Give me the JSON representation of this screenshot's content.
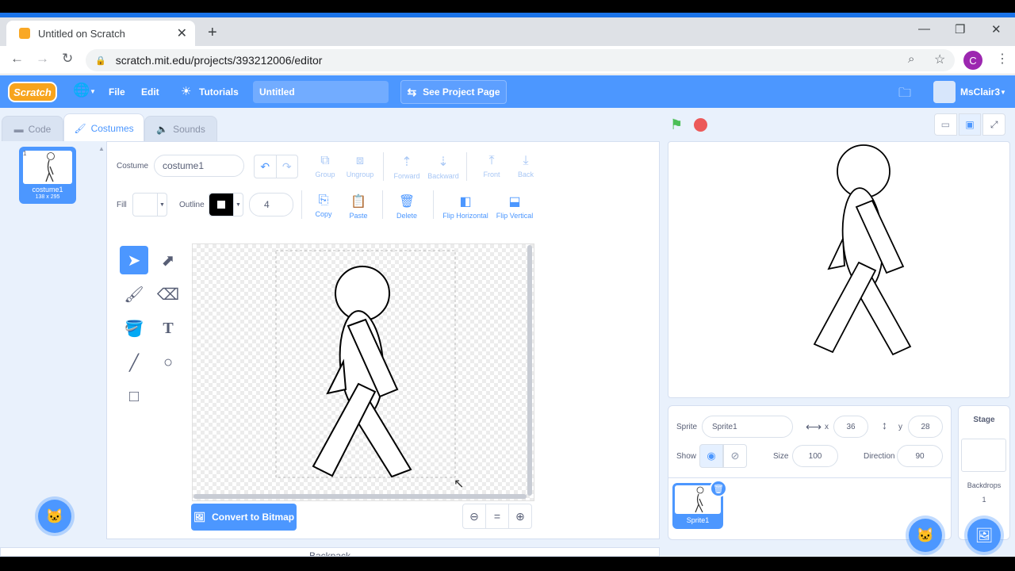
{
  "browser": {
    "tab_title": "Untitled on Scratch",
    "tab_close": "✕",
    "new_tab": "+",
    "url": "scratch.mit.edu/projects/393212006/editor",
    "profile_initial": "C",
    "window_controls": [
      "—",
      "❐",
      "✕"
    ]
  },
  "menubar": {
    "logo": "Scratch",
    "file": "File",
    "edit": "Edit",
    "tutorials": "Tutorials",
    "project_title": "Untitled",
    "see_project_page": "See Project Page",
    "username": "MsClair3"
  },
  "tabs": {
    "code": "Code",
    "costumes": "Costumes",
    "sounds": "Sounds"
  },
  "costume_list": [
    {
      "number": "1",
      "name": "costume1",
      "size": "138 x 295"
    }
  ],
  "paint": {
    "costume_label": "Costume",
    "costume_name": "costume1",
    "group": "Group",
    "ungroup": "Ungroup",
    "forward": "Forward",
    "backward": "Backward",
    "front": "Front",
    "back": "Back",
    "fill_label": "Fill",
    "outline_label": "Outline",
    "outline_width": "4",
    "copy": "Copy",
    "paste": "Paste",
    "delete": "Delete",
    "flip_horizontal": "Flip Horizontal",
    "flip_vertical": "Flip Vertical",
    "convert_bitmap": "Convert to Bitmap",
    "zoom_reset": "="
  },
  "backpack": "Backpack",
  "sprite": {
    "sprite_label": "Sprite",
    "sprite_name": "Sprite1",
    "x_label": "x",
    "x": "36",
    "y_label": "y",
    "y": "28",
    "show_label": "Show",
    "size_label": "Size",
    "size": "100",
    "direction_label": "Direction",
    "direction": "90",
    "thumb_name": "Sprite1"
  },
  "stage_panel": {
    "title": "Stage",
    "backdrops_label": "Backdrops",
    "backdrops_count": "1"
  },
  "colors": {
    "accent": "#4c97ff",
    "menubar": "#4c97ff",
    "flag": "#4cbf56",
    "stop": "#ec5959"
  }
}
